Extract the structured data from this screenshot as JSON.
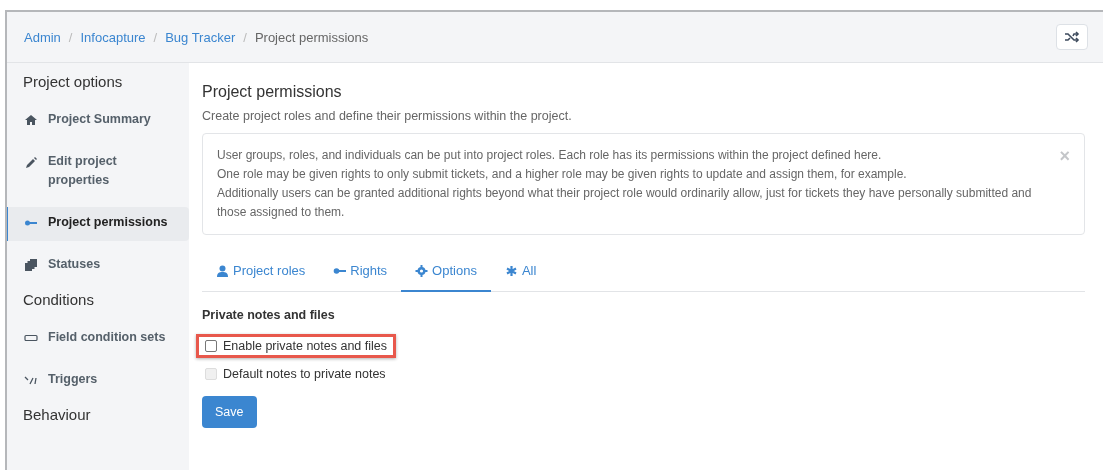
{
  "breadcrumb_separator": "/",
  "breadcrumb": [
    {
      "label": "Admin",
      "link": true
    },
    {
      "label": "Infocapture",
      "link": true
    },
    {
      "label": "Bug Tracker",
      "link": true
    },
    {
      "label": "Project permissions",
      "link": false
    }
  ],
  "sidebar": [
    {
      "kind": "heading",
      "label": "Project options"
    },
    {
      "kind": "item",
      "label": "Project Summary",
      "selected": false
    },
    {
      "kind": "item",
      "label": "Edit project properties",
      "selected": false
    },
    {
      "kind": "item",
      "label": "Project permissions",
      "selected": true
    },
    {
      "kind": "item",
      "label": "Statuses",
      "selected": false
    },
    {
      "kind": "heading",
      "label": "Conditions"
    },
    {
      "kind": "item",
      "label": "Field condition sets",
      "selected": false
    },
    {
      "kind": "item",
      "label": "Triggers",
      "selected": false
    },
    {
      "kind": "heading",
      "label": "Behaviour"
    }
  ],
  "page": {
    "title": "Project permissions",
    "subtitle": "Create project roles and define their permissions within the project.",
    "info": [
      "User groups, roles, and individuals can be put into project roles. Each role has its permissions within the project defined here.",
      "One role may be given rights to only submit tickets, and a higher role may be given rights to update and assign them, for example.",
      "Additionally users can be granted additional rights beyond what their project role would ordinarily allow, just for tickets they have personally submitted and those assigned to them."
    ],
    "info_close": "×"
  },
  "tabs": [
    {
      "label": "Project roles",
      "selected": false
    },
    {
      "label": "Rights",
      "selected": false
    },
    {
      "label": "Options",
      "selected": true
    },
    {
      "label": "All",
      "selected": false
    }
  ],
  "section": {
    "title": "Private notes and files",
    "options": [
      {
        "label": "Enable private notes and files",
        "checked": false,
        "disabled": false,
        "highlighted": true
      },
      {
        "label": "Default notes to private notes",
        "checked": false,
        "disabled": true,
        "highlighted": false
      }
    ]
  },
  "save_button": "Save"
}
